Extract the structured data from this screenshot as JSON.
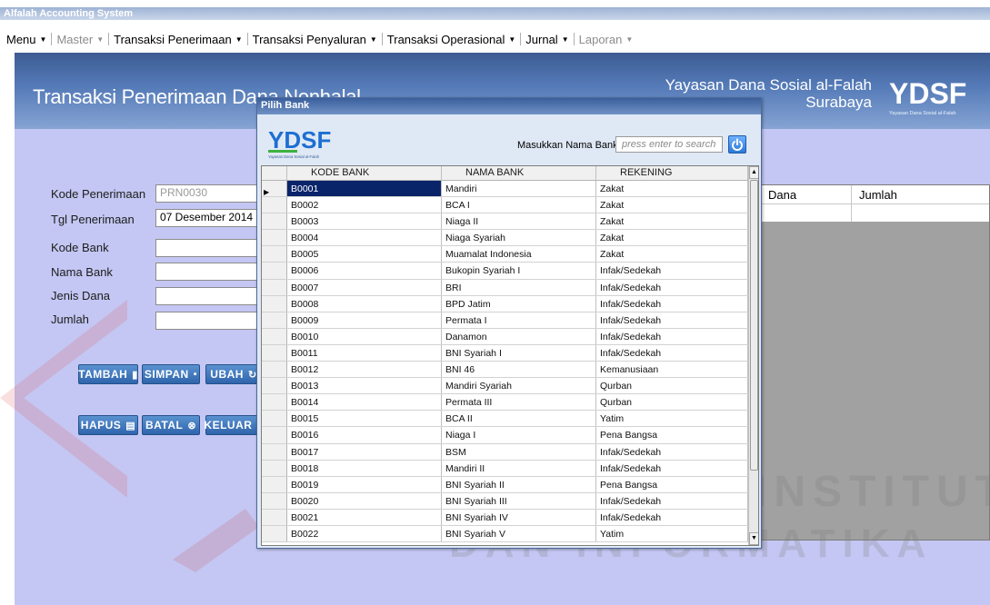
{
  "window": {
    "title": "Alfalah Accounting System"
  },
  "menu": {
    "items": [
      {
        "label": "Menu",
        "disabled": false
      },
      {
        "label": "Master",
        "disabled": true
      },
      {
        "label": "Transaksi Penerimaan",
        "disabled": false
      },
      {
        "label": "Transaksi Penyaluran",
        "disabled": false
      },
      {
        "label": "Transaksi Operasional",
        "disabled": false
      },
      {
        "label": "Jurnal",
        "disabled": false
      },
      {
        "label": "Laporan",
        "disabled": true
      }
    ]
  },
  "header": {
    "title": "Transaksi Penerimaan Dana Nonhalal",
    "org_line1": "Yayasan Dana Sosial al-Falah",
    "org_line2": "Surabaya",
    "logo_text": "YDSF",
    "logo_subtext": "Yayasan Dana Sosial al-Falah"
  },
  "form": {
    "kode_penerimaan_label": "Kode Penerimaan",
    "kode_penerimaan_value": "PRN0030",
    "tgl_penerimaan_label": "Tgl Penerimaan",
    "tgl_penerimaan_value": "07 Desember 2014",
    "kode_bank_label": "Kode Bank",
    "nama_bank_label": "Nama Bank",
    "jenis_dana_label": "Jenis Dana",
    "jumlah_label": "Jumlah"
  },
  "buttons": {
    "tambah": "TAMBAH",
    "simpan": "SIMPAN",
    "ubah": "UBAH",
    "hapus": "HAPUS",
    "batal": "BATAL",
    "keluar": "KELUAR"
  },
  "right_grid": {
    "col_dana": "Dana",
    "col_jumlah": "Jumlah"
  },
  "watermark": {
    "line1": "INSTITUT BISNIS",
    "line2": "DAN INFORMATIKA"
  },
  "dialog": {
    "title": "Pilih Bank",
    "logo_text": "YDSF",
    "logo_subtext": "Yayasan Dana Sosial al-Falah",
    "search_label": "Masukkan Nama Bank",
    "search_placeholder": "press enter to search",
    "columns": [
      "KODE BANK",
      "NAMA BANK",
      "REKENING"
    ],
    "rows": [
      [
        "B0001",
        "Mandiri",
        "Zakat"
      ],
      [
        "B0002",
        "BCA I",
        "Zakat"
      ],
      [
        "B0003",
        "Niaga II",
        "Zakat"
      ],
      [
        "B0004",
        "Niaga Syariah",
        "Zakat"
      ],
      [
        "B0005",
        "Muamalat Indonesia",
        "Zakat"
      ],
      [
        "B0006",
        "Bukopin Syariah I",
        "Infak/Sedekah"
      ],
      [
        "B0007",
        "BRI",
        "Infak/Sedekah"
      ],
      [
        "B0008",
        "BPD Jatim",
        "Infak/Sedekah"
      ],
      [
        "B0009",
        "Permata I",
        "Infak/Sedekah"
      ],
      [
        "B0010",
        "Danamon",
        "Infak/Sedekah"
      ],
      [
        "B0011",
        "BNI Syariah I",
        "Infak/Sedekah"
      ],
      [
        "B0012",
        "BNI 46",
        "Kemanusiaan"
      ],
      [
        "B0013",
        "Mandiri Syariah",
        "Qurban"
      ],
      [
        "B0014",
        "Permata III",
        "Qurban"
      ],
      [
        "B0015",
        "BCA II",
        "Yatim"
      ],
      [
        "B0016",
        "Niaga I",
        "Pena Bangsa"
      ],
      [
        "B0017",
        "BSM",
        "Infak/Sedekah"
      ],
      [
        "B0018",
        "Mandiri II",
        "Infak/Sedekah"
      ],
      [
        "B0019",
        "BNI Syariah II",
        "Pena Bangsa"
      ],
      [
        "B0020",
        "BNI Syariah III",
        "Infak/Sedekah"
      ],
      [
        "B0021",
        "BNI Syariah IV",
        "Infak/Sedekah"
      ],
      [
        "B0022",
        "BNI Syariah V",
        "Yatim"
      ]
    ],
    "selected_row": 0
  },
  "colors": {
    "panel_bg": "#c4c7f3",
    "header_band": "#557bb8",
    "button_blue": "#2f64ab",
    "selection": "#0a246a"
  }
}
